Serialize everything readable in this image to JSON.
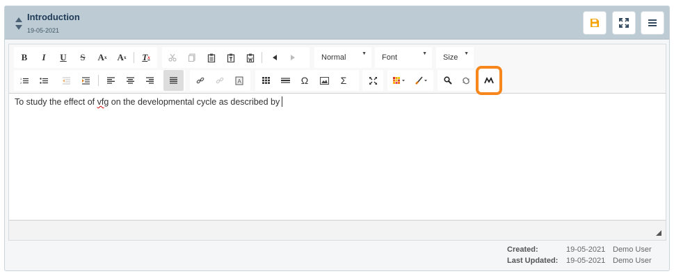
{
  "header": {
    "title": "Introduction",
    "date": "19-05-2021",
    "buttons": {
      "save": "save-icon",
      "expand": "expand-icon",
      "menu": "menu-icon"
    }
  },
  "toolbar": {
    "row1": {
      "bold": "B",
      "italic": "I",
      "underline": "U",
      "strike": "S",
      "subscript": "A",
      "subscript_mark": "x",
      "superscript": "A",
      "superscript_mark": "x",
      "remove_format": "T",
      "remove_format_mark": "x",
      "format_value": "Normal",
      "font_value": "Font",
      "size_value": "Size"
    },
    "row2": {
      "special_char": "Ω",
      "formula": "Σ"
    }
  },
  "content": {
    "text_before": "To study the effect of ",
    "misspelled_word": "vfg",
    "text_after": " on the developmental cycle as described by"
  },
  "footer": {
    "created_label": "Created:",
    "created_date": "19-05-2021",
    "created_user": "Demo User",
    "updated_label": "Last Updated:",
    "updated_date": "19-05-2021",
    "updated_user": "Demo User"
  },
  "colors": {
    "header_bg": "#bccbd4",
    "accent_orange": "#f7861d",
    "save_icon": "#f5a300",
    "title": "#1e3a56"
  }
}
